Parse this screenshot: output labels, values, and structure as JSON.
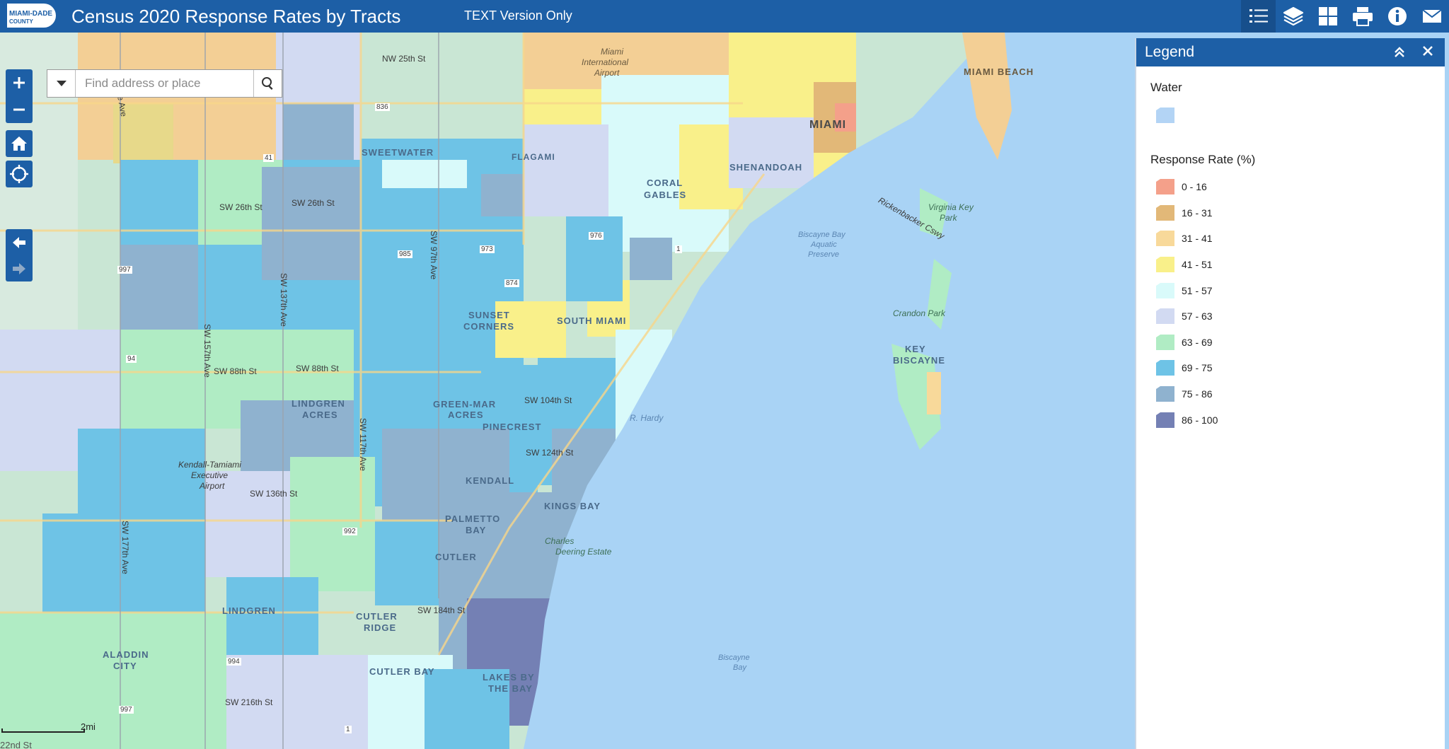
{
  "header": {
    "title": "Census 2020 Response Rates by Tracts",
    "text_version_link": "TEXT Version Only",
    "logo_text_top": "MIAMI-DADE",
    "logo_text_bottom": "COUNTY",
    "toolbar": [
      {
        "name": "legend-list-icon",
        "active": true
      },
      {
        "name": "layers-icon",
        "active": false
      },
      {
        "name": "basemap-gallery-icon",
        "active": false
      },
      {
        "name": "print-icon",
        "active": false
      },
      {
        "name": "info-icon",
        "active": false
      },
      {
        "name": "mail-icon",
        "active": false
      }
    ]
  },
  "search": {
    "placeholder": "Find address or place"
  },
  "map": {
    "labels": {
      "miami": "MIAMI",
      "miami_beach": "MIAMI BEACH",
      "sweetwater": "SWEETWATER",
      "flagami": "FLAGAMI",
      "coral": "CORAL",
      "gables": "GABLES",
      "shenandoah": "SHENANDOAH",
      "sunset": "SUNSET",
      "corners": "CORNERS",
      "south_miami": "SOUTH MIAMI",
      "lindgren": "LINDGREN",
      "acres": "ACRES",
      "green_mar": "GREEN-MAR",
      "green_acres": "ACRES",
      "pinecrest": "PINECREST",
      "kendall": "KENDALL",
      "kings_bay": "KINGS BAY",
      "palmetto": "PALMETTO",
      "bay": "BAY",
      "cutler": "CUTLER",
      "cutler_ridge_1": "CUTLER",
      "cutler_ridge_2": "RIDGE",
      "lindgren2": "LINDGREN",
      "aladdin": "ALADDIN",
      "city": "CITY",
      "cutler_bay": "CUTLER BAY",
      "lakes_by": "LAKES BY",
      "the_bay": "THE BAY",
      "key": "KEY",
      "biscayne": "BISCAYNE",
      "miami_airport_1": "Miami",
      "miami_airport_2": "International",
      "miami_airport_3": "Airport",
      "kendall_tamiami_1": "Kendall-Tamiami",
      "kendall_tamiami_2": "Executive",
      "kendall_tamiami_3": "Airport",
      "nw25": "NW 25th St",
      "sw26a": "SW 26th St",
      "sw26b": "SW 26th St",
      "sw88a": "SW 88th St",
      "sw88b": "SW 88th St",
      "sw104": "SW 104th St",
      "sw124": "SW 124th St",
      "sw136": "SW 136th St",
      "sw184": "SW 184th St",
      "sw216": "SW 216th St",
      "sw97": "SW 97th Ave",
      "sw117": "SW 117th Ave",
      "sw137": "SW 137th Ave",
      "sw157": "SW 157th Ave",
      "sw177": "SW 177th Ave",
      "krome": "Krome Ave",
      "biscayne_bay_preserve_1": "Biscayne Bay",
      "biscayne_bay_preserve_2": "Aquatic",
      "biscayne_bay_preserve_3": "Preserve",
      "biscayne_bay": "Biscayne",
      "biscayne_bay2": "Bay",
      "virginia_key": "Virginia Key",
      "virginia_park": "Park",
      "crandon": "Crandon Park",
      "charles_1": "Charles",
      "charles_2": "Deering Estate",
      "harris": "R. Hardy",
      "rickenbacker": "Rickenbacker Cswy",
      "route_836": "836",
      "route_41": "41",
      "route_973": "973",
      "route_985": "985",
      "route_976": "976",
      "route_874": "874",
      "route_1": "1",
      "route_1b": "1",
      "route_997": "997",
      "route_997b": "997",
      "route_94": "94",
      "route_992": "992",
      "route_994": "994"
    }
  },
  "scalebar": {
    "label": "2mi",
    "partial": "22nd St"
  },
  "legend": {
    "title": "Legend",
    "water_label": "Water",
    "water_color": "#b3d4f5",
    "response_label": "Response Rate (%)",
    "items": [
      {
        "label": "0 - 16",
        "color": "#f4a08a"
      },
      {
        "label": "16 - 31",
        "color": "#e2b878"
      },
      {
        "label": "31 - 41",
        "color": "#f8d99a"
      },
      {
        "label": "41 - 51",
        "color": "#f9f08a"
      },
      {
        "label": "51 - 57",
        "color": "#d9fafa"
      },
      {
        "label": "57 - 63",
        "color": "#d2daf2"
      },
      {
        "label": "63 - 69",
        "color": "#b0ecc4"
      },
      {
        "label": "69 - 75",
        "color": "#6ec3e6"
      },
      {
        "label": "75 - 86",
        "color": "#8fb2cf"
      },
      {
        "label": "86 - 100",
        "color": "#7480b4"
      }
    ]
  }
}
